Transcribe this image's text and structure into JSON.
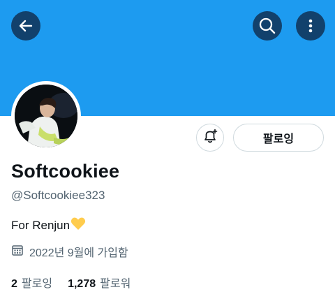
{
  "colors": {
    "banner": "#1d9bf0",
    "text_primary": "#0f1419",
    "text_secondary": "#536471",
    "border": "#cfd9de"
  },
  "header": {
    "back_icon": "arrow-left-icon",
    "search_icon": "search-icon",
    "more_icon": "more-vertical-icon"
  },
  "profile": {
    "display_name": "Softcookiee",
    "handle": "@Softcookiee323",
    "bio_text": "For Renjun",
    "bio_emoji": "yellow-heart",
    "joined_icon": "calendar-icon",
    "joined_text": "2022년 9월에 가입함",
    "notify_icon": "bell-plus-icon",
    "follow_label": "팔로잉"
  },
  "stats": [
    {
      "count": "2",
      "label": "팔로잉"
    },
    {
      "count": "1,278",
      "label": "팔로워"
    }
  ]
}
